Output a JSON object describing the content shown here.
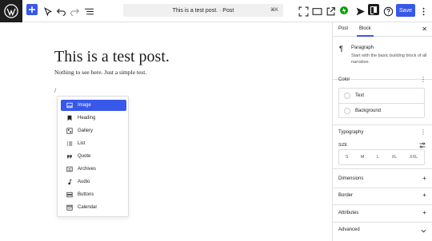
{
  "toolbar": {
    "document_title": "This is a test post. · Post",
    "shortcut": "⌘K",
    "save_label": "Save"
  },
  "editor": {
    "post_title": "This is a test post.",
    "paragraph": "Nothing to see here. Just a simple test.",
    "slash_text": "/"
  },
  "inserter": {
    "items": [
      {
        "label": "Image",
        "icon": "image-icon"
      },
      {
        "label": "Heading",
        "icon": "bookmark-icon"
      },
      {
        "label": "Gallery",
        "icon": "gallery-icon"
      },
      {
        "label": "List",
        "icon": "list-icon"
      },
      {
        "label": "Quote",
        "icon": "quote-icon"
      },
      {
        "label": "Archives",
        "icon": "archive-icon"
      },
      {
        "label": "Audio",
        "icon": "music-note-icon"
      },
      {
        "label": "Buttons",
        "icon": "buttons-icon"
      },
      {
        "label": "Calendar",
        "icon": "calendar-icon"
      }
    ],
    "active_index": 0
  },
  "sidebar": {
    "tabs": [
      "Post",
      "Block"
    ],
    "active_tab": "Block",
    "block": {
      "name": "Paragraph",
      "description": "Start with the basic building block of all narrative."
    },
    "color": {
      "title": "Color",
      "items": [
        "Text",
        "Background"
      ]
    },
    "typography": {
      "title": "Typography",
      "size_label": "SIZE",
      "sizes": [
        "S",
        "M",
        "L",
        "XL",
        "XXL"
      ]
    },
    "panels": [
      "Dimensions",
      "Border",
      "Attributes",
      "Advanced"
    ]
  },
  "colors": {
    "accent": "#3858e9",
    "dark": "#1e1e1e",
    "jetpack": "#069e08"
  }
}
